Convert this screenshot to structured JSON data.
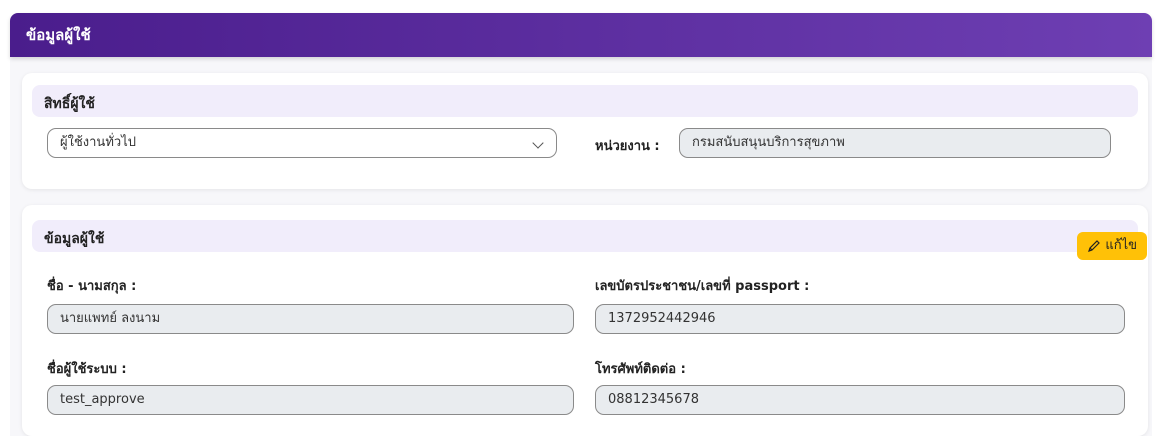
{
  "page": {
    "title": "ข้อมูลผู้ใช้"
  },
  "permissions_section": {
    "title": "สิทธิ์ผู้ใช้",
    "role_select_value": "ผู้ใช้งานทั่วไป",
    "department_label": "หน่วยงาน :",
    "department_value": "กรมสนับสนุนบริการสุขภาพ"
  },
  "user_section": {
    "title": "ข้อมูลผู้ใช้",
    "edit_label": "แก้ไข",
    "name_label": "ชื่อ - นามสกุล :",
    "name_value": "นายแพทย์ ลงนาม",
    "id_label": "เลขบัตรประชาชน/เลขที่ passport :",
    "id_value": "1372952442946",
    "username_label": "ชื่อผู้ใช้ระบบ :",
    "username_value": "test_approve",
    "phone_label": "โทรศัพท์ติดต่อ :",
    "phone_value": "08812345678"
  },
  "colors": {
    "header_start": "#4a1d8c",
    "header_end": "#6e3fb3",
    "section_bg": "#f1edfb",
    "edit_button": "#ffc107"
  },
  "icons": {
    "edit": "pencil-icon",
    "dropdown": "chevron-down-icon"
  }
}
